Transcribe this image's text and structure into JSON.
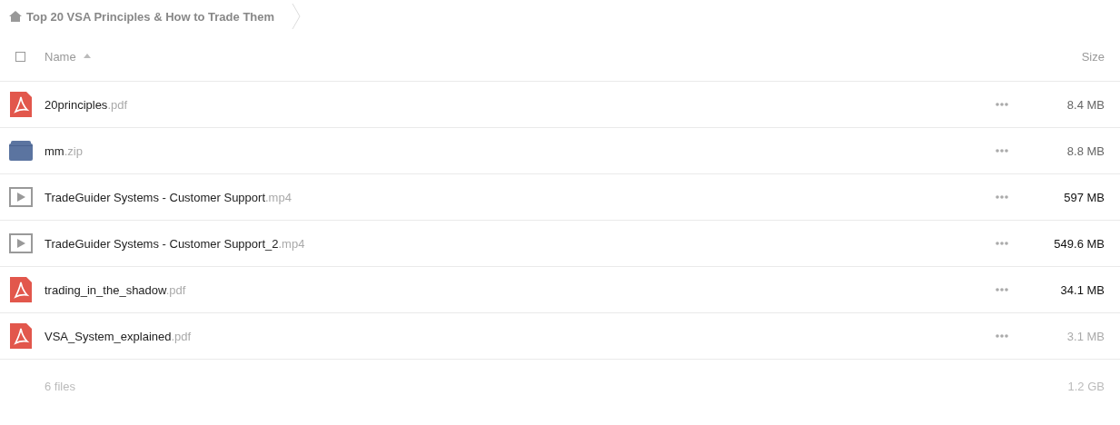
{
  "breadcrumb": {
    "title": "Top 20 VSA Principles & How to Trade Them"
  },
  "header": {
    "select_all_checked": false,
    "name_label": "Name",
    "sort_ascending": true,
    "size_label": "Size"
  },
  "files": [
    {
      "kind": "pdf",
      "name": "20principles",
      "ext": ".pdf",
      "size": "8.4 MB",
      "color": "#666666"
    },
    {
      "kind": "archive",
      "name": "mm",
      "ext": ".zip",
      "size": "8.8 MB",
      "color": "#666666"
    },
    {
      "kind": "video",
      "name": "TradeGuider Systems - Customer Support",
      "ext": ".mp4",
      "size": "597 MB",
      "color": "#111111"
    },
    {
      "kind": "video",
      "name": "TradeGuider Systems - Customer Support_2",
      "ext": ".mp4",
      "size": "549.6 MB",
      "color": "#111111"
    },
    {
      "kind": "pdf",
      "name": "trading_in_the_shadow",
      "ext": ".pdf",
      "size": "34.1 MB",
      "color": "#111111"
    },
    {
      "kind": "pdf",
      "name": "VSA_System_explained",
      "ext": ".pdf",
      "size": "3.1 MB",
      "color": "#aaaaaa"
    }
  ],
  "footer": {
    "count": "6 files",
    "total": "1.2 GB"
  }
}
